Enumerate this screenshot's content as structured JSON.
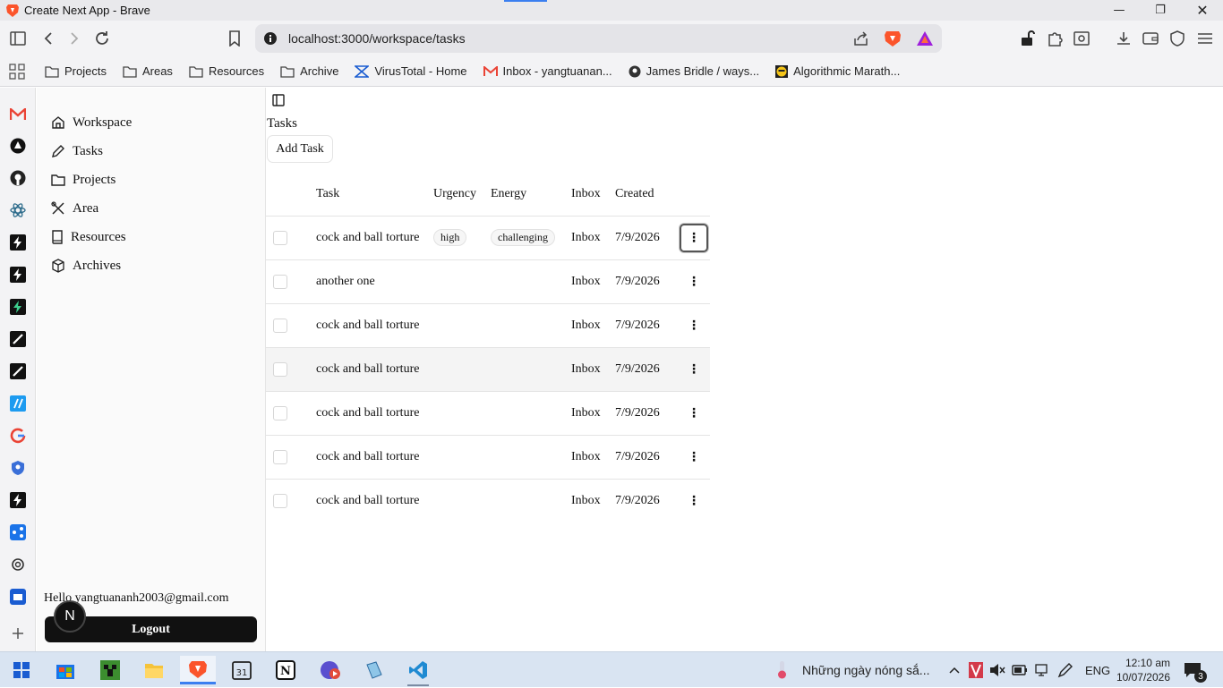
{
  "window": {
    "title": "Create Next App - Brave"
  },
  "toolbar": {
    "url": "localhost:3000/workspace/tasks"
  },
  "bookmarks": [
    {
      "label": "Projects"
    },
    {
      "label": "Areas"
    },
    {
      "label": "Resources"
    },
    {
      "label": "Archive"
    },
    {
      "label": "VirusTotal - Home"
    },
    {
      "label": "Inbox - yangtuanan..."
    },
    {
      "label": "James Bridle / ways..."
    },
    {
      "label": "Algorithmic Marath..."
    }
  ],
  "sidebar": {
    "items": [
      {
        "label": "Workspace",
        "icon": "home-icon"
      },
      {
        "label": "Tasks",
        "icon": "pencil-icon"
      },
      {
        "label": "Projects",
        "icon": "folder-icon"
      },
      {
        "label": "Area",
        "icon": "tools-icon"
      },
      {
        "label": "Resources",
        "icon": "book-icon"
      },
      {
        "label": "Archives",
        "icon": "box-icon"
      }
    ],
    "greeting": "Hello yangtuananh2003@gmail.com",
    "logout_label": "Logout",
    "avatar_letter": "N"
  },
  "main": {
    "title": "Tasks",
    "add_task_label": "Add Task",
    "columns": [
      "Task",
      "Urgency",
      "Energy",
      "Inbox",
      "Created"
    ],
    "rows": [
      {
        "task": "cock and ball torture",
        "urgency": "high",
        "energy": "challenging",
        "inbox": "Inbox",
        "created": "7/9/2026"
      },
      {
        "task": "another one",
        "urgency": "",
        "energy": "",
        "inbox": "Inbox",
        "created": "7/9/2026"
      },
      {
        "task": "cock and ball torture",
        "urgency": "",
        "energy": "",
        "inbox": "Inbox",
        "created": "7/9/2026"
      },
      {
        "task": "cock and ball torture",
        "urgency": "",
        "energy": "",
        "inbox": "Inbox",
        "created": "7/9/2026"
      },
      {
        "task": "cock and ball torture",
        "urgency": "",
        "energy": "",
        "inbox": "Inbox",
        "created": "7/9/2026"
      },
      {
        "task": "cock and ball torture",
        "urgency": "",
        "energy": "",
        "inbox": "Inbox",
        "created": "7/9/2026"
      },
      {
        "task": "cock and ball torture",
        "urgency": "",
        "energy": "",
        "inbox": "Inbox",
        "created": "7/9/2026"
      }
    ]
  },
  "taskbar": {
    "media": "Những ngày nóng sắ...",
    "language": "ENG",
    "time": "12:10 am",
    "date": "10/07/2026",
    "notifications": "3"
  },
  "colors": {
    "accent": "#3b7ff0",
    "brave": "#fb542b",
    "logout_bg": "#111111"
  }
}
